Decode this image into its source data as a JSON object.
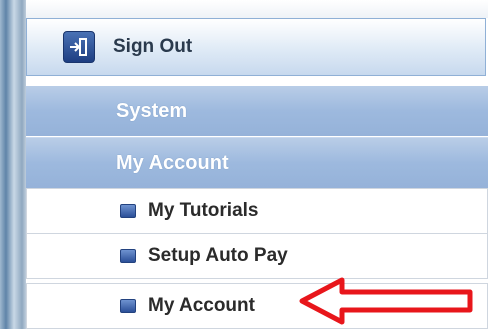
{
  "signout": {
    "label": "Sign Out",
    "icon": "sign-out-icon"
  },
  "sections": [
    {
      "label": "System"
    },
    {
      "label": "My Account"
    }
  ],
  "menu_items": [
    {
      "label": "My Tutorials",
      "icon": "bullet-icon"
    },
    {
      "label": "Setup Auto Pay",
      "icon": "bullet-icon"
    },
    {
      "label": "My Account",
      "icon": "bullet-icon"
    }
  ],
  "annotation": {
    "type": "red-arrow",
    "color": "#e8161b",
    "points_to": "My Account"
  },
  "colors": {
    "section_bg": "#9db9de",
    "border": "#8fb0d6",
    "bullet": "#2b4f98"
  }
}
